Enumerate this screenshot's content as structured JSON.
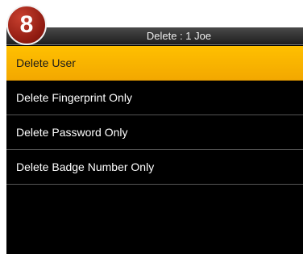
{
  "step_badge": "8",
  "titlebar": {
    "title": "Delete : 1 Joe"
  },
  "menu": {
    "items": [
      {
        "label": "Delete User",
        "selected": true
      },
      {
        "label": "Delete Fingerprint Only",
        "selected": false
      },
      {
        "label": "Delete Password Only",
        "selected": false
      },
      {
        "label": "Delete Badge Number Only",
        "selected": false
      }
    ]
  },
  "colors": {
    "selection": "#ffc000",
    "background": "#000000",
    "badge": "#8e1a10"
  }
}
